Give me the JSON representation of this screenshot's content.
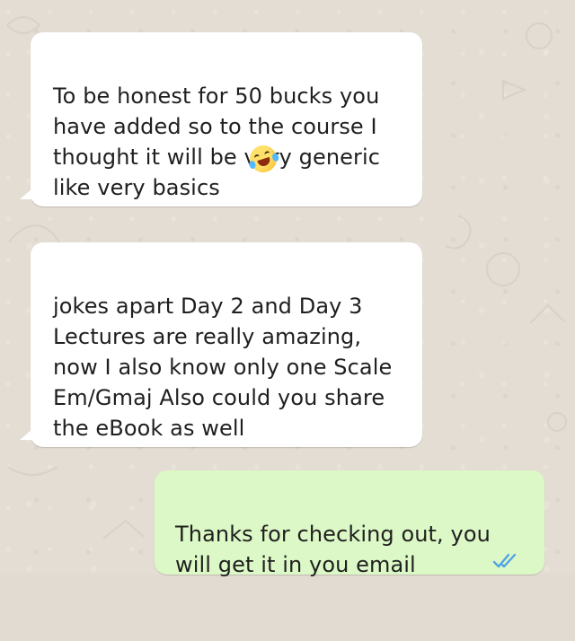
{
  "chat": {
    "messages": [
      {
        "direction": "incoming",
        "text": "To be honest for 50 bucks you\nhave added so to the course I\nthought it will be very generic\nlike very basics",
        "emoji_icon": "rolling-on-the-floor-laughing-emoji"
      },
      {
        "direction": "incoming",
        "text": "jokes apart Day 2 and Day 3\nLectures are really amazing,\nnow I also know only one Scale\nEm/Gmaj Also could you share\nthe eBook as well"
      },
      {
        "direction": "outgoing",
        "text": "Thanks for checking out, you\nwill get it in you email",
        "status_icon": "double-check-read-icon"
      }
    ]
  },
  "theme": {
    "chat_background": "#e4ddd3",
    "incoming_bubble": "#ffffff",
    "outgoing_bubble": "#dcf8c6",
    "text": "#1f1f1f",
    "read_receipt": "#4fa3e6"
  }
}
